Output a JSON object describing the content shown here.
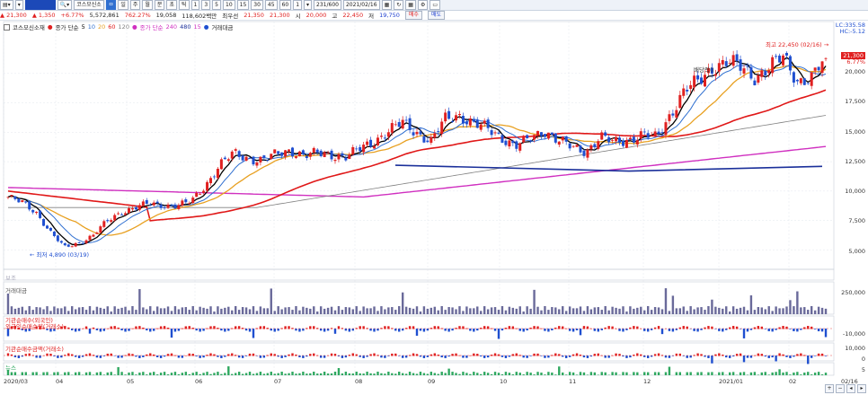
{
  "toolbar": {
    "stock_code_field": "",
    "stock_name": "코스모신소",
    "period_buttons": [
      "일",
      "주",
      "월",
      "분",
      "초",
      "틱"
    ],
    "minute_buttons": [
      "1",
      "3",
      "5",
      "10",
      "15",
      "30",
      "45",
      "60",
      "1"
    ],
    "count_field": "231/600",
    "date_field": "2021/02/16"
  },
  "infobar": {
    "price": "21,300",
    "change": "1,350",
    "change_pct": "+6.77%",
    "volume": "5,572,861",
    "vol_pct": "762.27%",
    "amount": "19,058",
    "amount_unit": "118,602백만",
    "pref": "최우선",
    "ask": "21,350",
    "bid": "21,300",
    "open_label": "시",
    "open": "20,000",
    "high_label": "고",
    "high": "22,450",
    "low_label": "저",
    "low": "19,750",
    "btn_buy": "매수",
    "btn_sell": "매도"
  },
  "legend": {
    "name": "코스모신소재",
    "ma_label": "종가 단순",
    "ma_short": [
      "5",
      "10",
      "20",
      "60",
      "120"
    ],
    "ma_long_label": "종가 단순",
    "ma_long": [
      "240",
      "480",
      "15"
    ],
    "extra": "거래대금"
  },
  "right_axis": {
    "lc": "LC:335.58",
    "hc": "HC:-5.12",
    "price_tag": "21,300",
    "pct_tag": "6.77%",
    "ticks": [
      "20,000",
      "17,500",
      "15,000",
      "12,500",
      "10,000",
      "7,500",
      "5,000"
    ]
  },
  "annotations": {
    "high_label": "최고 22,450 (02/16)",
    "low_label": "최저 4,890 (03/19)",
    "dividend": "배당락(I"
  },
  "panels": {
    "p1_title": "보조",
    "p2_title": "거래대금",
    "p2_tick": "250,000",
    "p3_title": "기관순매수(외국인)",
    "p3_title2": "외국인순매수량(거래소)",
    "p3_tick": "-10,000",
    "p4_title": "기관순매수금액(거래소)",
    "p4_tick1": "10,000",
    "p4_tick2": "0",
    "p5_title": "뉴스",
    "p5_tick": "5"
  },
  "xaxis": [
    "2020/03",
    "04",
    "05",
    "06",
    "07",
    "08",
    "09",
    "10",
    "11",
    "12",
    "2021/01",
    "02",
    "02/16"
  ],
  "colors": {
    "up": "#e02020",
    "down": "#1f4fd0",
    "ma5": "#000000",
    "ma10": "#2f6fd0",
    "ma20": "#e8a020",
    "ma60": "#e01818",
    "ma120": "#808080",
    "ma240": "#d030c0",
    "trend": "#1a2f9a",
    "news": "#2fa860"
  },
  "chart_data": {
    "type": "candlestick",
    "ylim": [
      3500,
      23500
    ],
    "series": [
      {
        "name": "종가",
        "values": [
          9500,
          9000,
          8200,
          6500,
          5200,
          5600,
          6200,
          7400,
          8200,
          8600,
          8900,
          8800,
          8750,
          9100,
          10500,
          12200,
          13200,
          12800,
          12600,
          13100,
          13500,
          13000,
          13200,
          13100,
          12900,
          13600,
          14300,
          15100,
          15800,
          15000,
          14200,
          16100,
          16500,
          15700,
          15300,
          14600,
          13800,
          14400,
          15200,
          14300,
          13700,
          13400,
          14600,
          14100,
          14400,
          14800,
          14500,
          16600,
          18600,
          19300,
          20600,
          21000,
          20500,
          19700,
          20500,
          21400,
          19400,
          19600,
          21300
        ]
      }
    ]
  }
}
